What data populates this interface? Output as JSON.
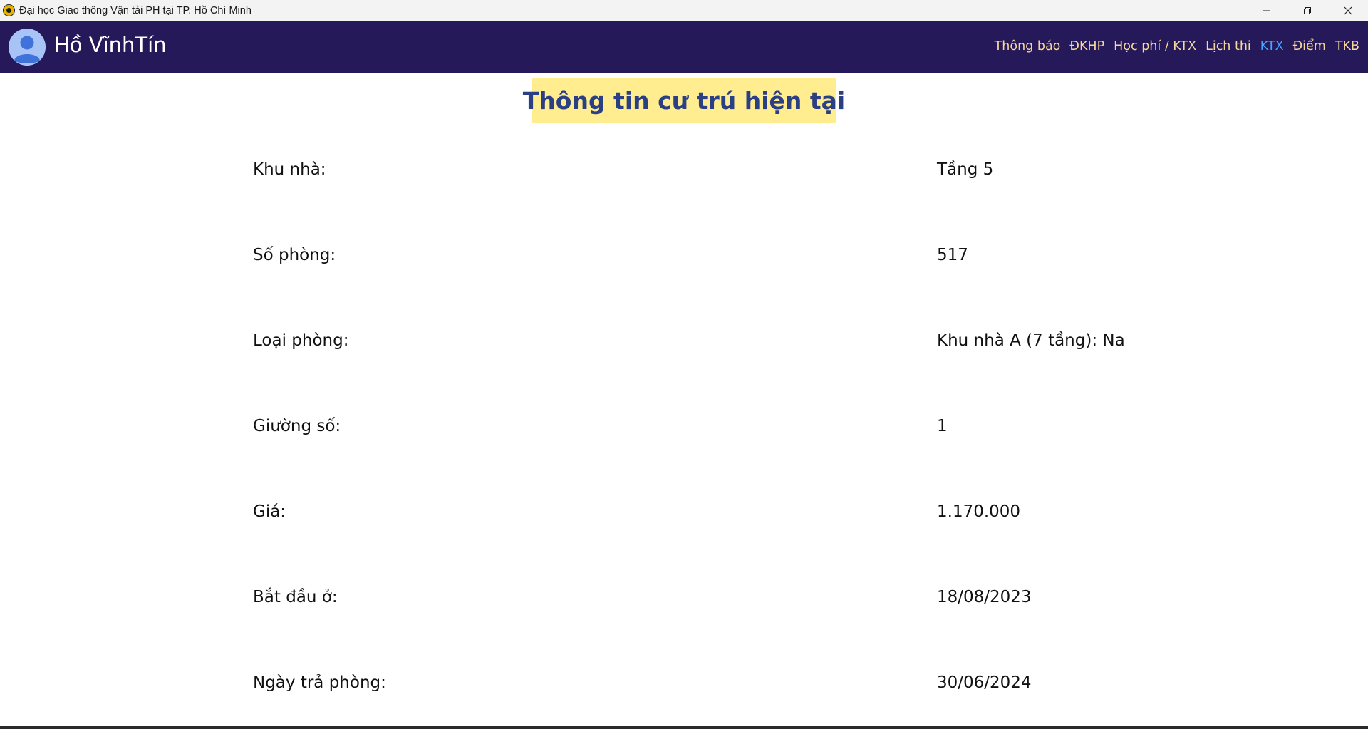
{
  "window": {
    "title": "Đại học Giao thông Vận tải PH tại TP. Hồ Chí Minh"
  },
  "header": {
    "user_name": "Hồ VĩnhTín",
    "nav": [
      {
        "label": "Thông báo",
        "active": false
      },
      {
        "label": "ĐKHP",
        "active": false
      },
      {
        "label": "Học phí / KTX",
        "active": false
      },
      {
        "label": "Lịch thi",
        "active": false
      },
      {
        "label": "KTX",
        "active": true
      },
      {
        "label": "Điểm",
        "active": false
      },
      {
        "label": "TKB",
        "active": false
      }
    ]
  },
  "main": {
    "title": "Thông tin cư trú hiện tại",
    "rows": [
      {
        "label": "Khu nhà:",
        "value": "Tầng 5"
      },
      {
        "label": "Số phòng:",
        "value": "517"
      },
      {
        "label": "Loại phòng:",
        "value": "Khu nhà A (7 tầng): Na"
      },
      {
        "label": "Giường số:",
        "value": "1"
      },
      {
        "label": "Giá:",
        "value": "1.170.000"
      },
      {
        "label": "Bắt đầu ở:",
        "value": "18/08/2023"
      },
      {
        "label": "Ngày trả phòng:",
        "value": "30/06/2024"
      }
    ]
  },
  "colors": {
    "navbar_bg": "#26195a",
    "nav_link": "#f7d79a",
    "nav_active": "#4aa3ff",
    "title_bg": "#ffed8f",
    "title_text": "#2b3f84"
  },
  "icons": {
    "app": "university-logo-icon",
    "avatar": "user-avatar-icon",
    "minimize": "minimize-icon",
    "restore": "restore-icon",
    "close": "close-icon"
  }
}
